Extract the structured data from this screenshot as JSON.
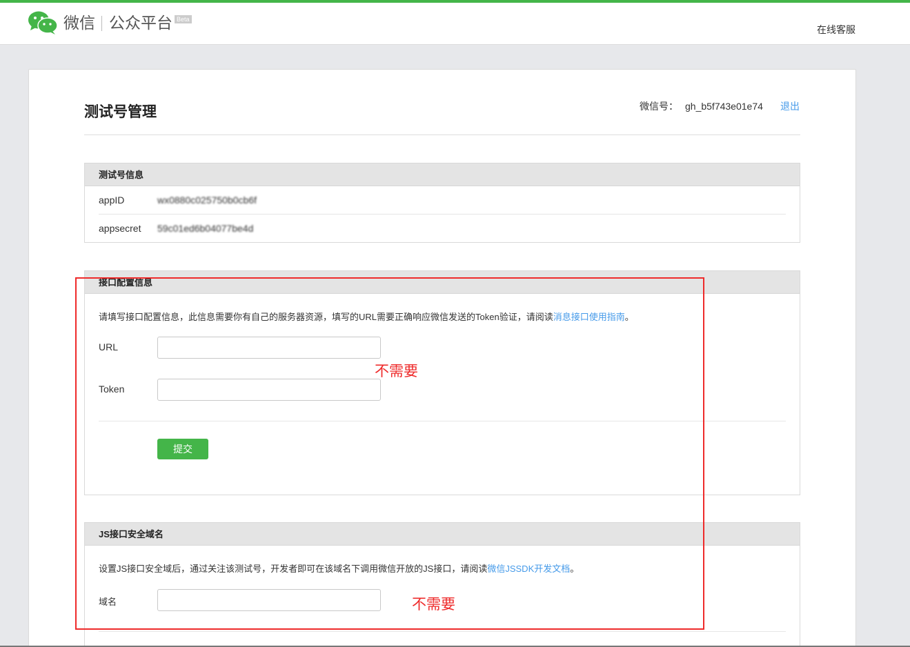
{
  "header": {
    "brand": "微信",
    "brand_sub": "公众平台",
    "beta": "Beta",
    "service_link": "在线客服"
  },
  "page": {
    "title": "测试号管理",
    "account_label": "微信号：",
    "account_id": "gh_b5f743e01e74",
    "logout": "退出"
  },
  "test_info": {
    "heading": "测试号信息",
    "rows": [
      {
        "label": "appID",
        "value": "wx0880c025750b0cb6f"
      },
      {
        "label": "appsecret",
        "value": "59c01ed6b04077be4d"
      }
    ]
  },
  "interface_config": {
    "heading": "接口配置信息",
    "desc_prefix": "请填写接口配置信息，此信息需要你有自己的服务器资源，填写的URL需要正确响应微信发送的Token验证，请阅读",
    "desc_link": "消息接口使用指南",
    "desc_suffix": "。",
    "url_label": "URL",
    "url_value": "",
    "token_label": "Token",
    "token_value": "",
    "submit": "提交"
  },
  "js_domain": {
    "heading": "JS接口安全域名",
    "desc_prefix": "设置JS接口安全域后，通过关注该测试号，开发者即可在该域名下调用微信开放的JS接口，请阅读",
    "desc_link": "微信JSSDK开发文档",
    "desc_suffix": "。",
    "domain_label": "域名",
    "domain_value": ""
  },
  "annotations": {
    "note_1": "不需要",
    "note_2": "不需要",
    "color": "#ee2a2a"
  },
  "colors": {
    "accent_green": "#44b549",
    "link_blue": "#459ae9"
  }
}
